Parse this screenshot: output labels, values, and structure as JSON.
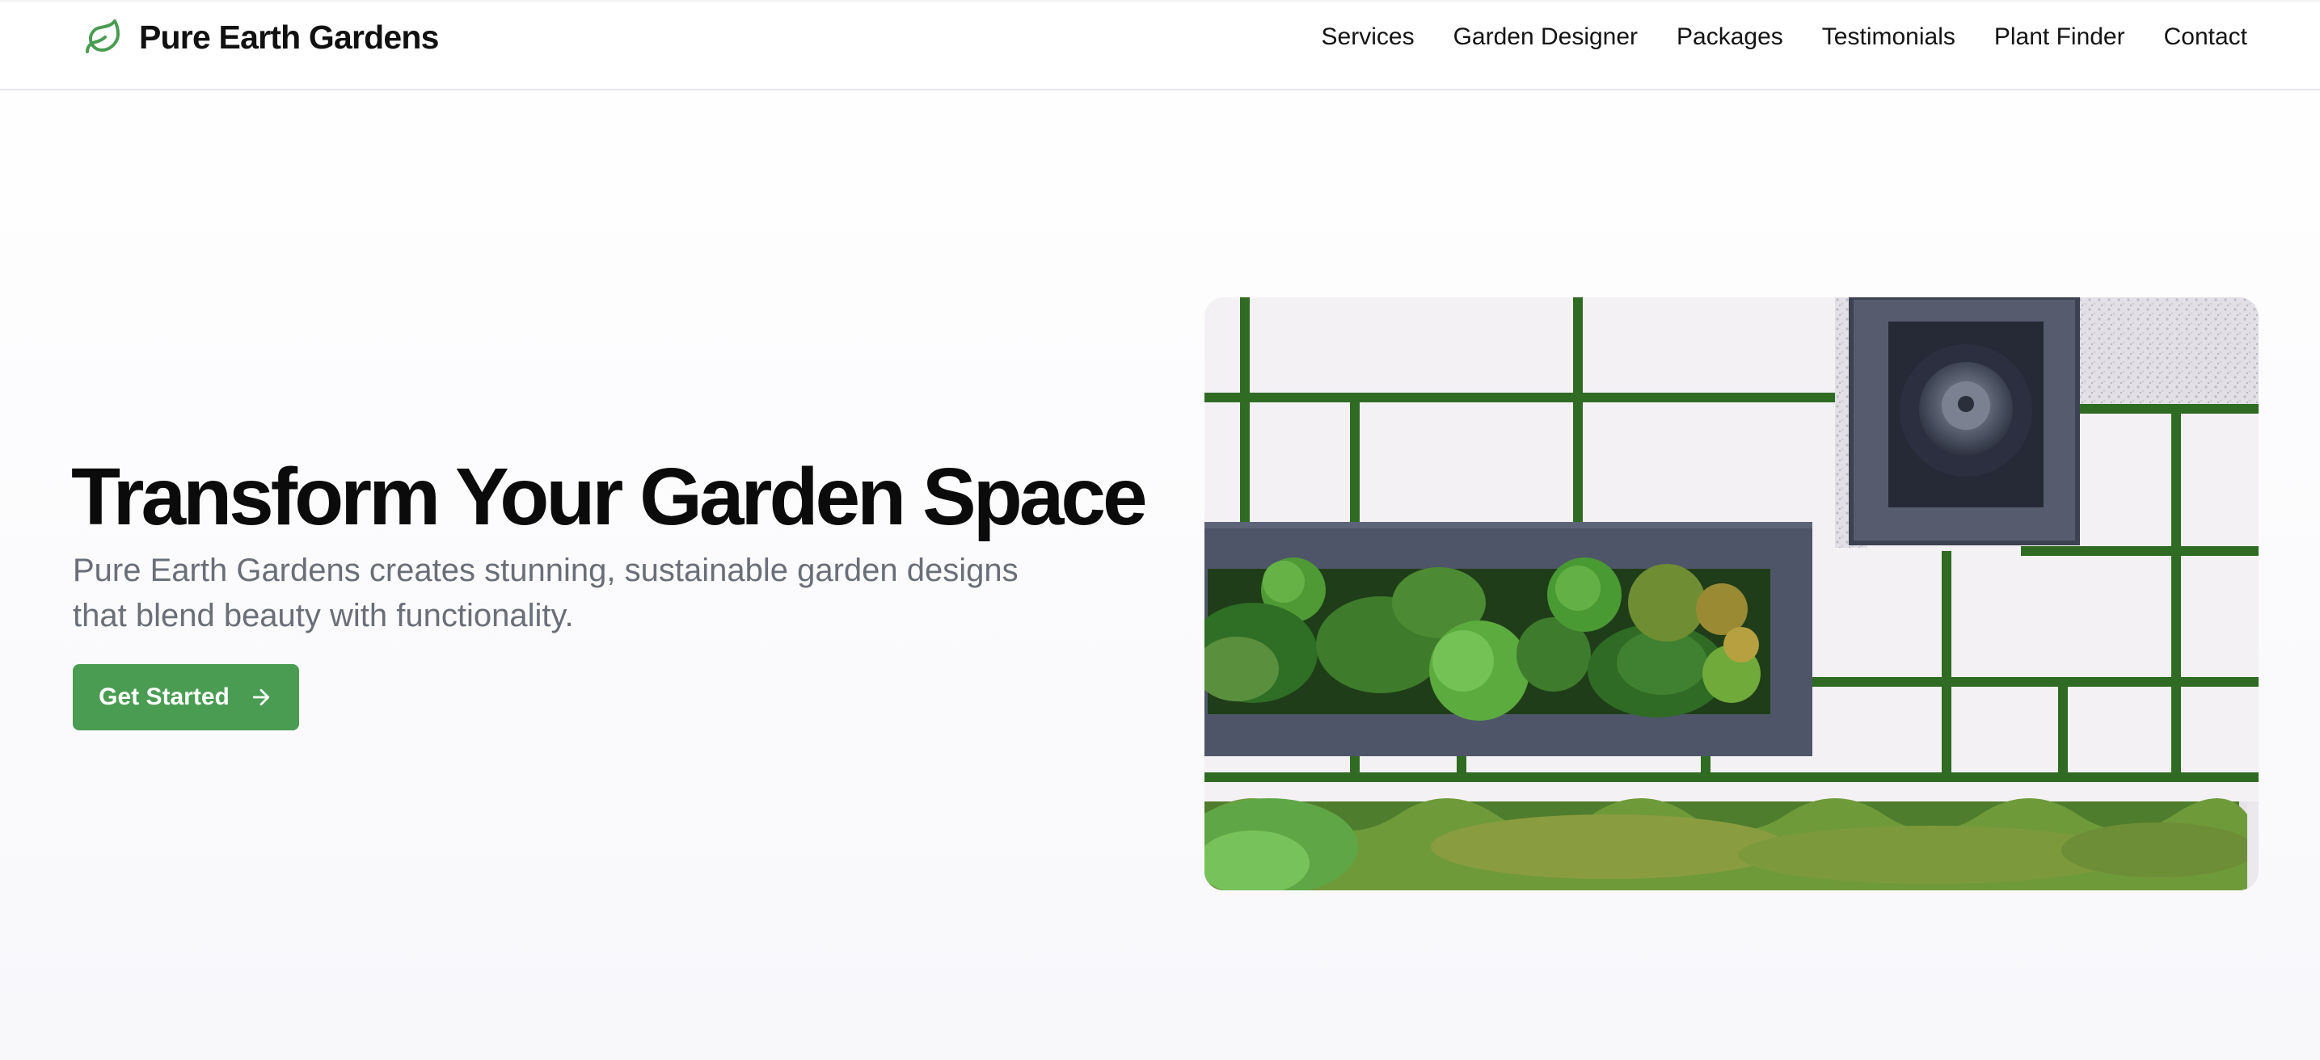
{
  "brand": {
    "name": "Pure Earth Gardens",
    "icon": "leaf-icon",
    "color": "#4a9c52"
  },
  "nav": {
    "items": [
      {
        "label": "Services"
      },
      {
        "label": "Garden Designer"
      },
      {
        "label": "Packages"
      },
      {
        "label": "Testimonials"
      },
      {
        "label": "Plant Finder"
      },
      {
        "label": "Contact"
      }
    ]
  },
  "hero": {
    "title": "Transform Your Garden Space",
    "subtitle": "Pure Earth Gardens creates stunning, sustainable garden designs that blend beauty with functionality.",
    "cta_label": "Get Started",
    "cta_icon": "arrow-right-icon",
    "cta_color": "#4a9c52"
  }
}
